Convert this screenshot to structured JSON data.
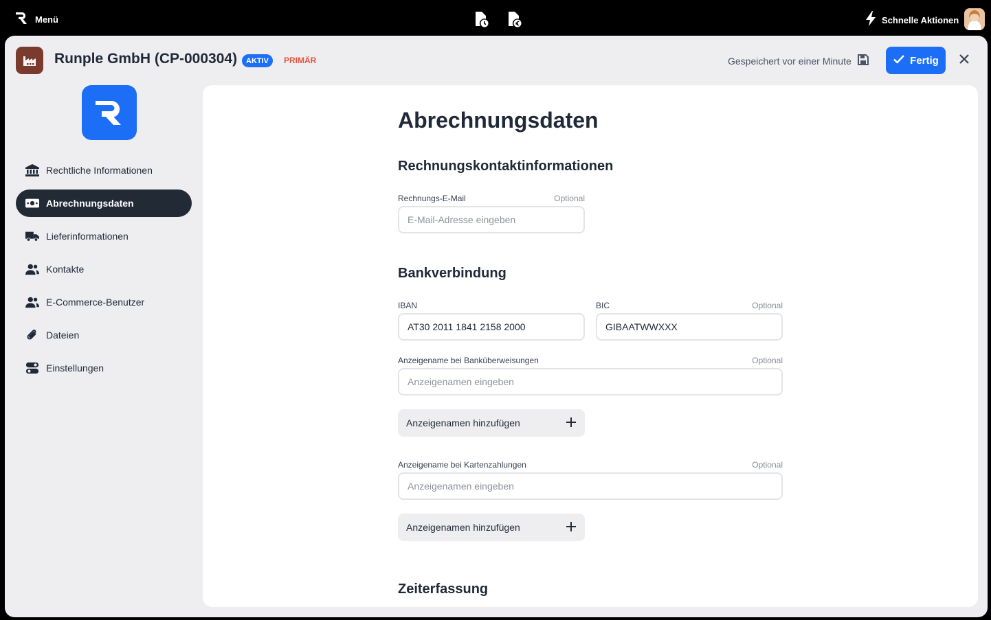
{
  "topbar": {
    "menu_label": "Menü",
    "quick_actions_label": "Schnelle Aktionen"
  },
  "header": {
    "title": "Runple GmbH (CP-000304)",
    "badge_active": "AKTIV",
    "badge_primary": "PRIMÄR",
    "saved_status": "Gespeichert vor einer Minute",
    "done_label": "Fertig"
  },
  "sidebar": {
    "items": [
      {
        "label": "Rechtliche Informationen",
        "icon": "bank-icon"
      },
      {
        "label": "Abrechnungsdaten",
        "icon": "money-icon",
        "active": true
      },
      {
        "label": "Lieferinformationen",
        "icon": "truck-icon"
      },
      {
        "label": "Kontakte",
        "icon": "users-icon"
      },
      {
        "label": "E-Commerce-Benutzer",
        "icon": "users-icon"
      },
      {
        "label": "Dateien",
        "icon": "paperclip-icon"
      },
      {
        "label": "Einstellungen",
        "icon": "toggles-icon"
      }
    ]
  },
  "main": {
    "page_title": "Abrechnungsdaten",
    "billing_contact": {
      "title": "Rechnungskontaktinformationen",
      "email_label": "Rechnungs-E-Mail",
      "email_optional": "Optional",
      "email_placeholder": "E-Mail-Adresse eingeben",
      "email_value": ""
    },
    "bank": {
      "title": "Bankverbindung",
      "iban_label": "IBAN",
      "iban_value": "AT30 2011 1841 2158 2000",
      "bic_label": "BIC",
      "bic_optional": "Optional",
      "bic_value": "GIBAATWWXXX",
      "transfer_name_label": "Anzeigename bei Banküberweisungen",
      "transfer_name_optional": "Optional",
      "transfer_name_placeholder": "Anzeigenamen eingeben",
      "transfer_add_label": "Anzeigenamen hinzufügen",
      "card_name_label": "Anzeigename bei Kartenzahlungen",
      "card_name_optional": "Optional",
      "card_name_placeholder": "Anzeigenamen eingeben",
      "card_add_label": "Anzeigenamen hinzufügen"
    },
    "time_tracking": {
      "title": "Zeiterfassung"
    }
  }
}
